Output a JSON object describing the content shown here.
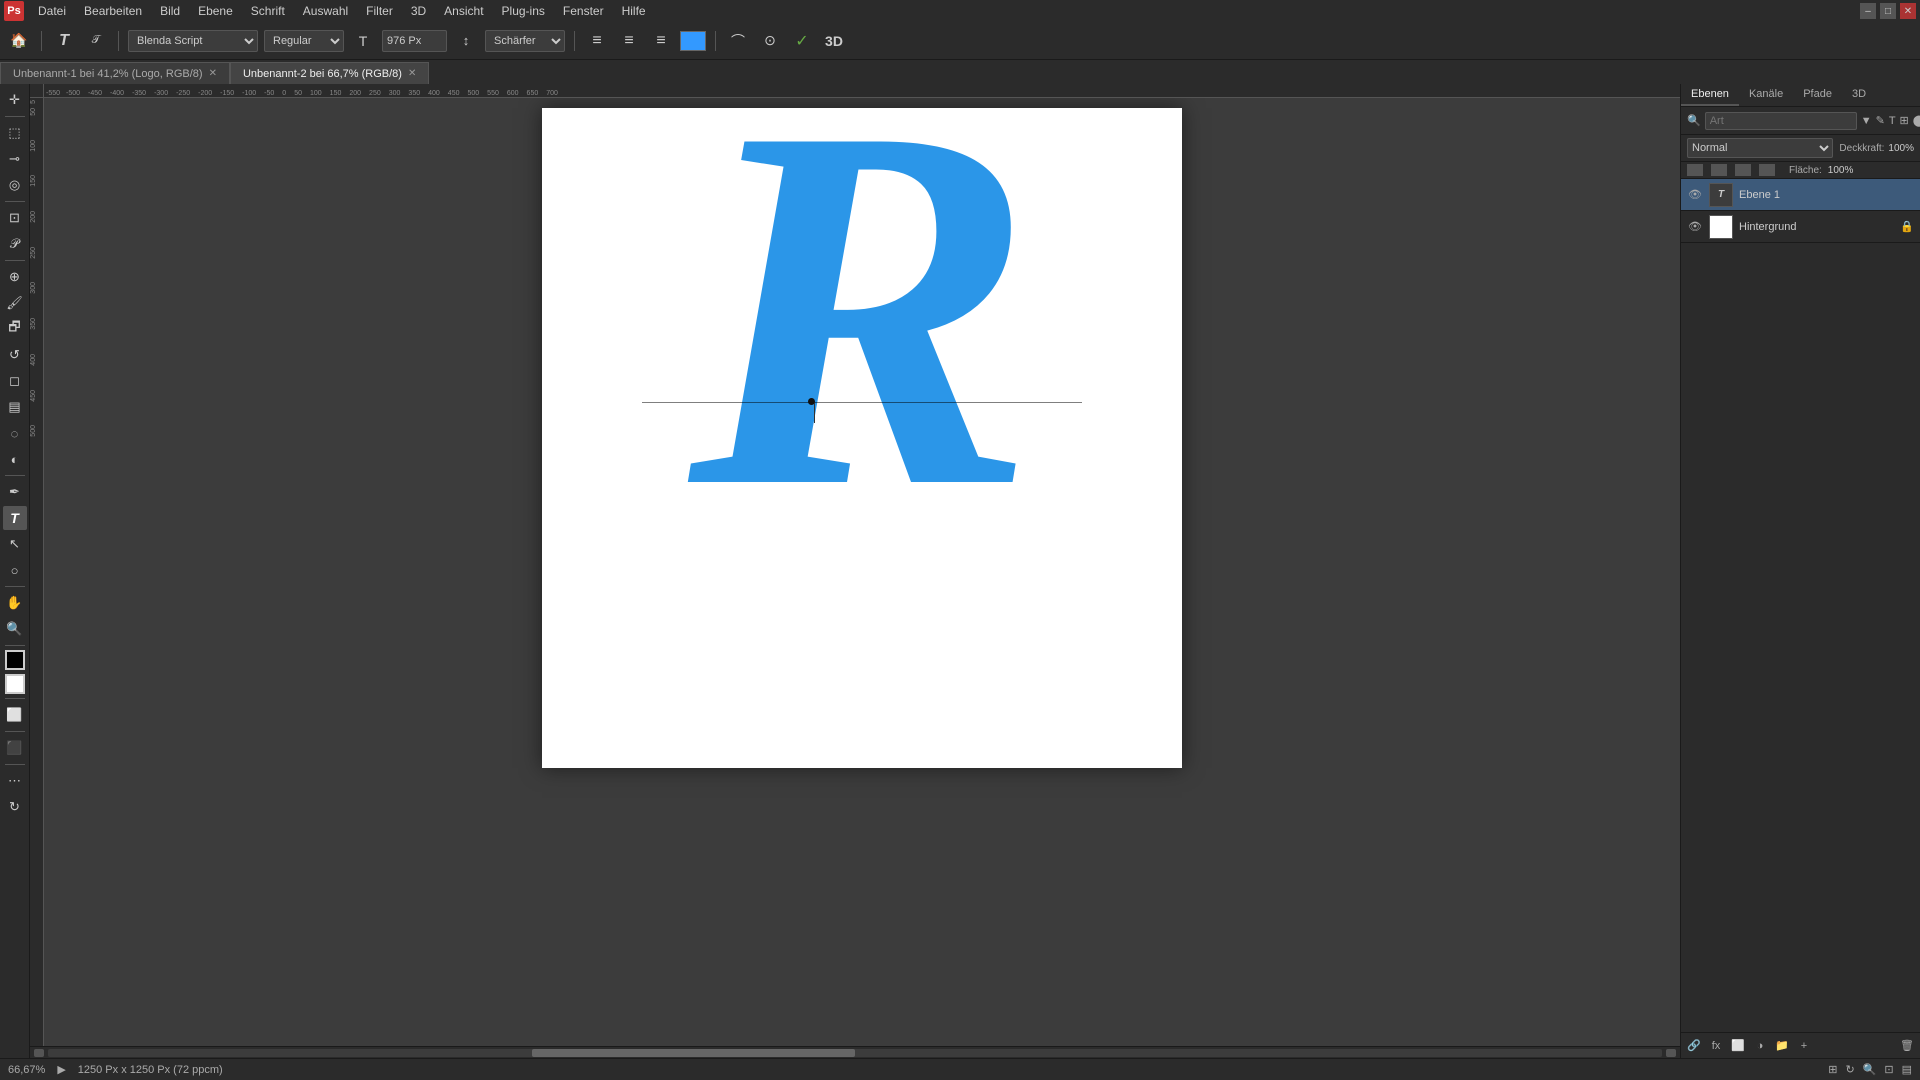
{
  "app": {
    "title": "Adobe Photoshop"
  },
  "menu": {
    "items": [
      "Datei",
      "Bearbeiten",
      "Bild",
      "Ebene",
      "Schrift",
      "Auswahl",
      "Filter",
      "3D",
      "Ansicht",
      "Plug-ins",
      "Fenster",
      "Hilfe"
    ]
  },
  "toolbar": {
    "font_name": "Blenda Script",
    "font_style": "Regular",
    "font_size": "976 Px",
    "sharpening": "Schärfer",
    "align_left": "⬛",
    "align_center": "⬛",
    "align_right": "⬛"
  },
  "tabs": [
    {
      "label": "Unbenannt-1 bei 41,2% (Logo, RGB/8)",
      "active": false
    },
    {
      "label": "Unbenannt-2 bei 66,7% (RGB/8)",
      "active": true
    }
  ],
  "panels": {
    "tabs": [
      "Ebenen",
      "Kanäle",
      "Pfade",
      "3D"
    ]
  },
  "layers_panel": {
    "search_placeholder": "Art",
    "mode": "Normal",
    "opacity_label": "Deckkraft:",
    "opacity_value": "100%",
    "fill_label": "Fläche:",
    "fill_value": "100%",
    "layers": [
      {
        "name": "Ebene 1",
        "type": "text",
        "visible": true,
        "locked": false,
        "active": true
      },
      {
        "name": "Hintergrund",
        "type": "white",
        "visible": true,
        "locked": true,
        "active": false
      }
    ]
  },
  "status_bar": {
    "zoom": "66,67%",
    "dimensions": "1250 Px x 1250 Px (72 ppcm)"
  },
  "canvas": {
    "letter": "R",
    "letter_color": "#2b96e8"
  }
}
